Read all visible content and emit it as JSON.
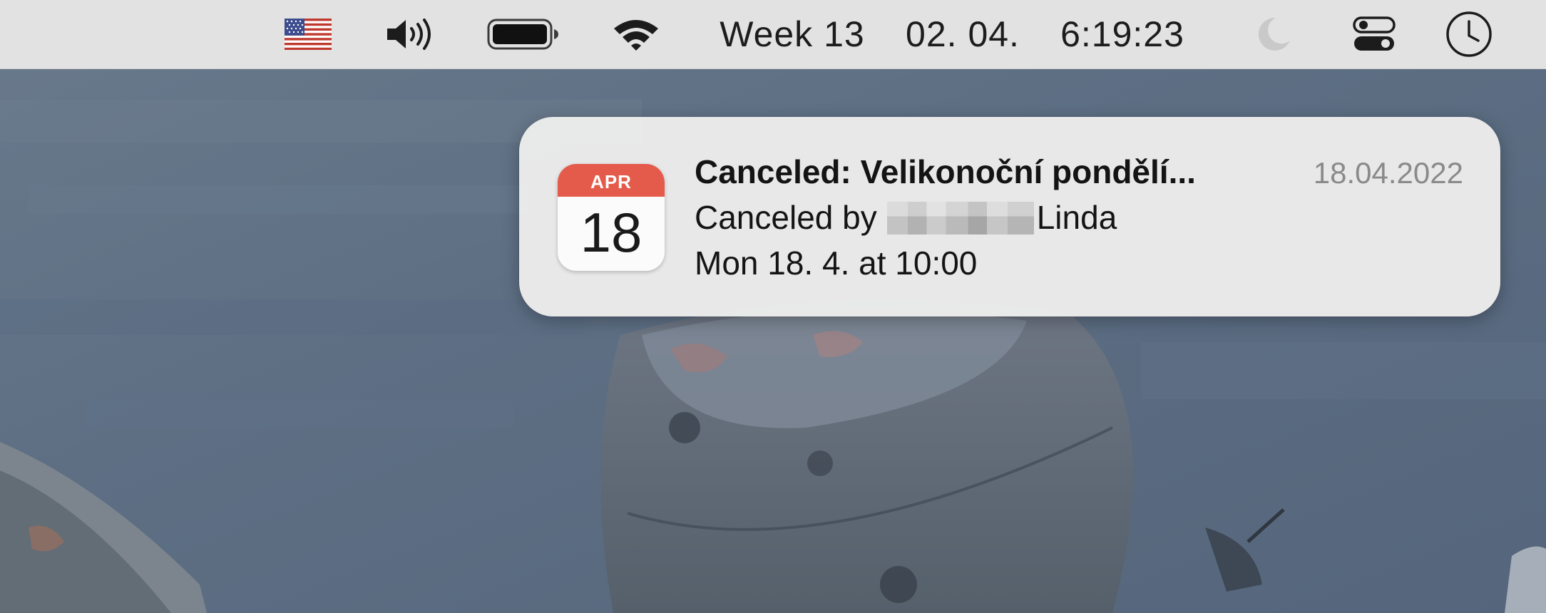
{
  "menubar": {
    "input_source_flag": "us-flag-icon",
    "volume_icon": "speaker-volume-icon",
    "battery_icon": "battery-full-icon",
    "wifi_icon": "wifi-icon",
    "week": "Week 13",
    "date": "02. 04.",
    "time": "6:19:23",
    "focus_icon": "moon-icon",
    "control_center_icon": "control-center-toggles-icon",
    "clock_icon": "clock-icon",
    "colors": {
      "bar_background": "#e2e2e2",
      "text": "#1c1c1c"
    }
  },
  "notification": {
    "app_icon": {
      "name": "calendar-app-icon",
      "month": "APR",
      "day": "18"
    },
    "title": "Canceled: Velikonoční pondělí...",
    "date": "18.04.2022",
    "canceled_by_prefix": "Canceled by",
    "canceled_by_name": "Linda",
    "event_time": "Mon 18. 4. at 10:00",
    "colors": {
      "background": "#ececec",
      "calendar_red": "#e45b4c",
      "date_text": "#8a8a8a"
    }
  }
}
